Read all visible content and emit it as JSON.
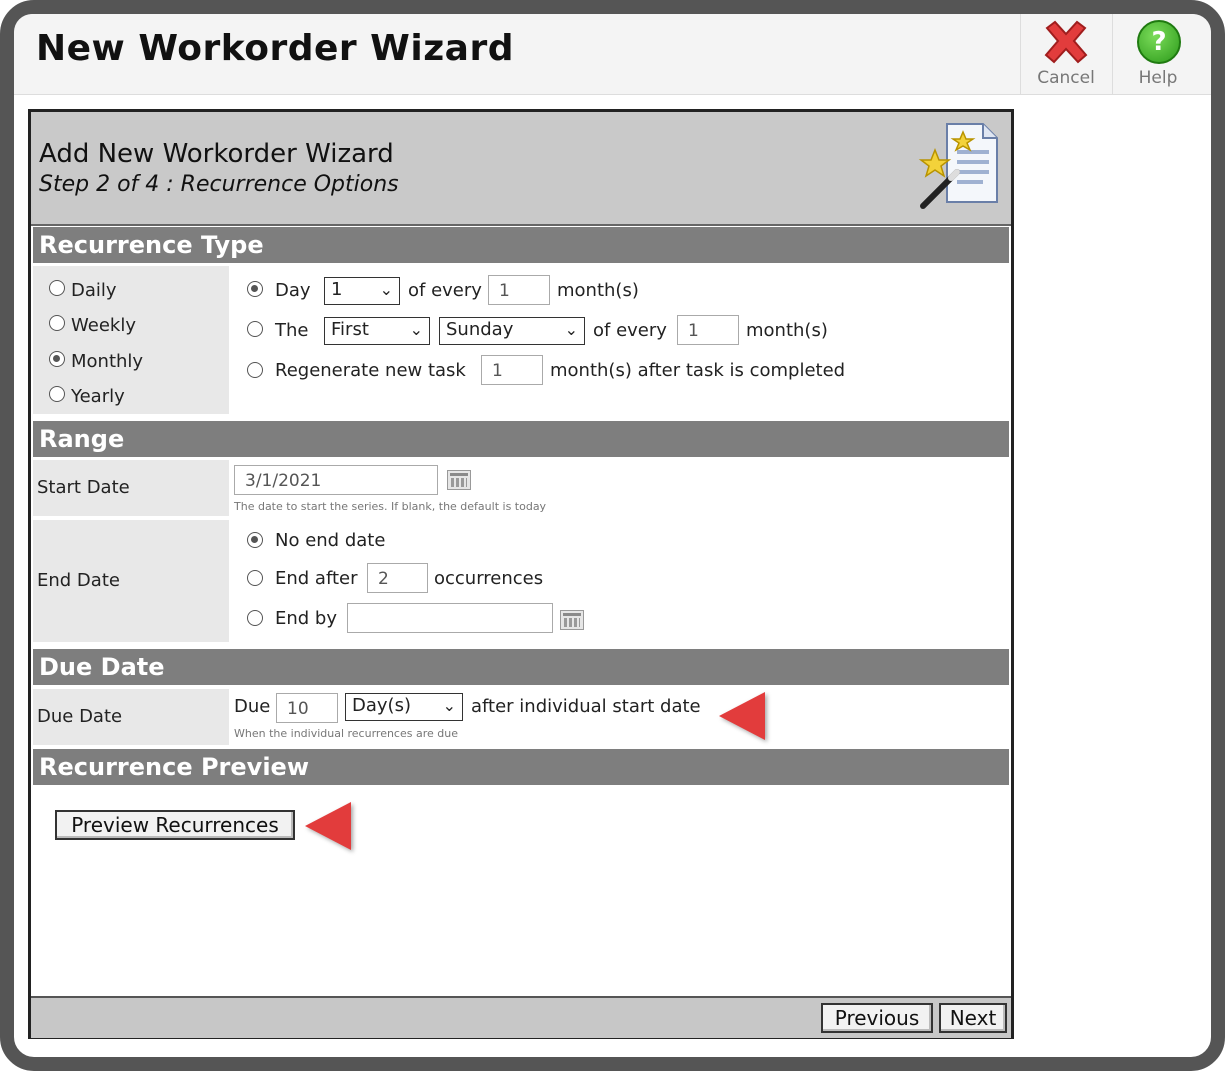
{
  "app": {
    "title": "New Workorder Wizard",
    "cancel_label": "Cancel",
    "help_label": "Help",
    "help_glyph": "?"
  },
  "wizard": {
    "title": "Add New Workorder Wizard",
    "step": "Step 2 of 4 : Recurrence Options"
  },
  "recurrence_type": {
    "header": "Recurrence Type",
    "options": [
      "Daily",
      "Weekly",
      "Monthly",
      "Yearly"
    ],
    "selected": "Monthly",
    "row1": {
      "prefix": "Day",
      "day_value": "1",
      "mid": "of every",
      "every_value": "1",
      "suffix": "month(s)"
    },
    "row2": {
      "prefix": "The",
      "ordinal_value": "First",
      "weekday_value": "Sunday",
      "mid": "of every",
      "every_value": "1",
      "suffix": "month(s)"
    },
    "row3": {
      "prefix": "Regenerate new task",
      "value": "1",
      "suffix": "month(s) after task is completed"
    }
  },
  "range": {
    "header": "Range",
    "start_label": "Start Date",
    "start_value": "3/1/2021",
    "start_hint": "The date to start the series. If blank, the default is today",
    "end_label": "End Date",
    "no_end": "No end date",
    "end_after": "End after",
    "end_after_value": "2",
    "occurrences": "occurrences",
    "end_by": "End by",
    "end_by_value": ""
  },
  "due": {
    "header": "Due Date",
    "label": "Due Date",
    "prefix": "Due",
    "value": "10",
    "unit": "Day(s)",
    "suffix": "after individual start date",
    "hint": "When the individual recurrences are due"
  },
  "preview": {
    "header": "Recurrence Preview",
    "button": "Preview Recurrences"
  },
  "nav": {
    "previous": "Previous",
    "next": "Next"
  },
  "colors": {
    "section_bar": "#7e7e7e",
    "annotation_arrow": "#e23c3c",
    "cancel_icon": "#e23c3c",
    "help_icon": "#2c9a1a"
  }
}
